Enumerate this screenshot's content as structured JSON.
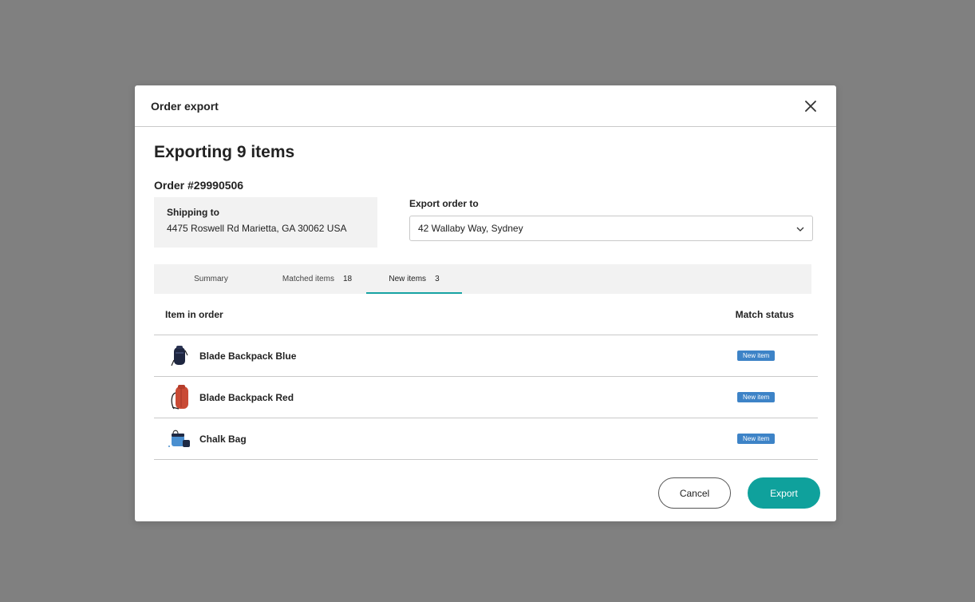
{
  "modal": {
    "title": "Order export",
    "heading": "Exporting 9 items",
    "order_number": "Order #29990506"
  },
  "shipping": {
    "label": "Shipping to",
    "address": "4475 Roswell Rd Marietta, GA 30062 USA"
  },
  "export_to": {
    "label": "Export order to",
    "selected": "42 Wallaby Way, Sydney"
  },
  "tabs": [
    {
      "label": "Summary",
      "count": ""
    },
    {
      "label": "Matched items",
      "count": "18"
    },
    {
      "label": "New items",
      "count": "3",
      "active": true
    }
  ],
  "table": {
    "headers": [
      "Item in order",
      "Match status"
    ],
    "rows": [
      {
        "name": "Blade Backpack Blue",
        "status": "New item",
        "icon": "backpack-blue-icon"
      },
      {
        "name": "Blade Backpack Red",
        "status": "New item",
        "icon": "backpack-red-icon"
      },
      {
        "name": "Chalk Bag",
        "status": "New item",
        "icon": "chalk-bag-icon"
      }
    ]
  },
  "actions": {
    "cancel": "Cancel",
    "export": "Export"
  },
  "colors": {
    "accent": "#0fa19c",
    "badge": "#3d83c7",
    "overlay": "#808080"
  }
}
